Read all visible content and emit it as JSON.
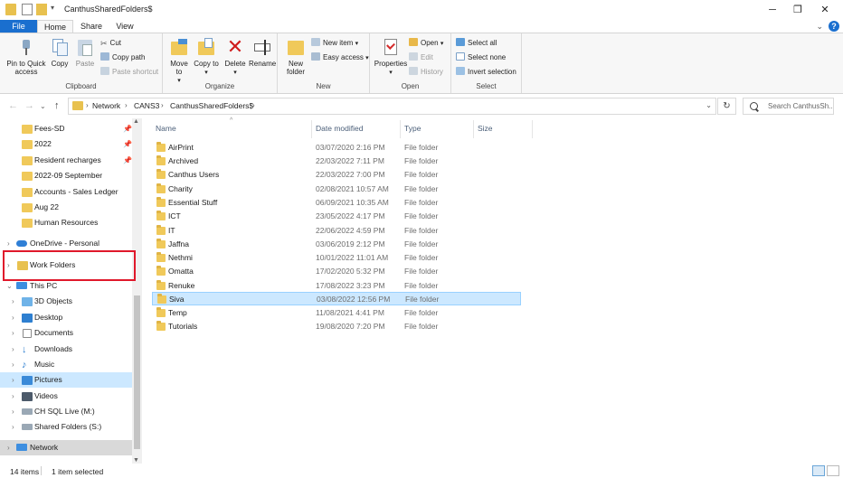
{
  "window": {
    "title": "CanthusSharedFolders$",
    "minimize": "─",
    "maximize": "❐",
    "close": "✕"
  },
  "ribbon_tabs": {
    "file": "File",
    "home": "Home",
    "share": "Share",
    "view": "View"
  },
  "ribbon": {
    "clipboard": {
      "label": "Clipboard",
      "pin": "Pin to Quick access",
      "copy": "Copy",
      "paste": "Paste",
      "cut": "Cut",
      "copy_path": "Copy path",
      "paste_shortcut": "Paste shortcut"
    },
    "organize": {
      "label": "Organize",
      "move_to": "Move to",
      "copy_to": "Copy to",
      "delete": "Delete",
      "rename": "Rename"
    },
    "new": {
      "label": "New",
      "new_folder": "New folder",
      "new_item": "New item",
      "easy_access": "Easy access"
    },
    "open": {
      "label": "Open",
      "properties": "Properties",
      "open": "Open",
      "edit": "Edit",
      "history": "History"
    },
    "select": {
      "label": "Select",
      "select_all": "Select all",
      "select_none": "Select none",
      "invert": "Invert selection"
    }
  },
  "address": {
    "crumbs": [
      "Network",
      "CANS3",
      "CanthusSharedFolders$"
    ],
    "search_placeholder": "Search CanthusSh..."
  },
  "nav": {
    "quick_access": [
      "Fees-SD",
      "2022",
      "Resident recharges",
      "2022-09 September",
      "Accounts - Sales Ledger",
      "Aug 22",
      "Human Resources"
    ],
    "onedrive": "OneDrive - Personal",
    "work_folders": "Work Folders",
    "this_pc": "This PC",
    "pc_items": [
      "3D Objects",
      "Desktop",
      "Documents",
      "Downloads",
      "Music",
      "Pictures",
      "Videos",
      "CH SQL Live (M:)",
      "Shared Folders (S:)"
    ],
    "network": "Network"
  },
  "columns": {
    "name": "Name",
    "date": "Date modified",
    "type": "Type",
    "size": "Size"
  },
  "files": [
    {
      "name": "AirPrint",
      "date": "03/07/2020 2:16 PM",
      "type": "File folder"
    },
    {
      "name": "Archived",
      "date": "22/03/2022 7:11 PM",
      "type": "File folder"
    },
    {
      "name": "Canthus Users",
      "date": "22/03/2022 7:00 PM",
      "type": "File folder"
    },
    {
      "name": "Charity",
      "date": "02/08/2021 10:57 AM",
      "type": "File folder"
    },
    {
      "name": "Essential Stuff",
      "date": "06/09/2021 10:35 AM",
      "type": "File folder"
    },
    {
      "name": "ICT",
      "date": "23/05/2022 4:17 PM",
      "type": "File folder"
    },
    {
      "name": "IT",
      "date": "22/06/2022 4:59 PM",
      "type": "File folder"
    },
    {
      "name": "Jaffna",
      "date": "03/06/2019 2:12 PM",
      "type": "File folder"
    },
    {
      "name": "Nethmi",
      "date": "10/01/2022 11:01 AM",
      "type": "File folder"
    },
    {
      "name": "Omatta",
      "date": "17/02/2020 5:32 PM",
      "type": "File folder"
    },
    {
      "name": "Renuke",
      "date": "17/08/2022 3:23 PM",
      "type": "File folder"
    },
    {
      "name": "Siva",
      "date": "03/08/2022 12:56 PM",
      "type": "File folder"
    },
    {
      "name": "Temp",
      "date": "11/08/2021 4:41 PM",
      "type": "File folder"
    },
    {
      "name": "Tutorials",
      "date": "19/08/2020 7:20 PM",
      "type": "File folder"
    }
  ],
  "status": {
    "count": "14 items",
    "selected": "1 item selected"
  },
  "colors": {
    "accent": "#1a6fcf",
    "selection": "#cce8ff",
    "highlight_box": "#e0182b",
    "folder": "#f0c95a"
  }
}
